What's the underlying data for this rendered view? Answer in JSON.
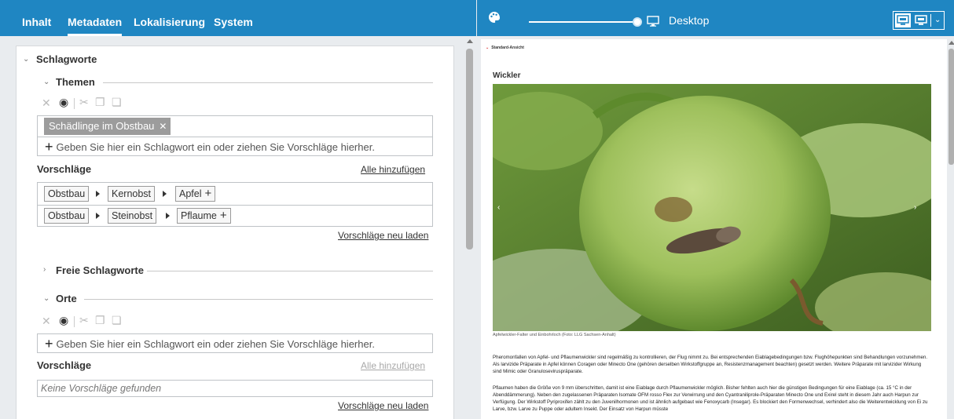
{
  "left": {
    "tabs": [
      {
        "label": "Inhalt",
        "active": false
      },
      {
        "label": "Metadaten",
        "active": true
      },
      {
        "label": "Lokalisierung",
        "active": false
      },
      {
        "label": "System",
        "active": false
      }
    ],
    "keywords_section": {
      "title": "Schlagworte",
      "themes": {
        "title": "Themen",
        "selected_tag": "Schädlinge im Obstbau",
        "input_placeholder": "Geben Sie hier ein Schlagwort ein oder ziehen Sie Vorschläge hierher.",
        "suggestions_label": "Vorschläge",
        "add_all": "Alle hinzufügen",
        "suggestion_rows": [
          [
            "Obstbau",
            "Kernobst",
            "Apfel"
          ],
          [
            "Obstbau",
            "Steinobst",
            "Pflaume"
          ]
        ],
        "reload": "Vorschläge neu laden"
      },
      "free": {
        "title": "Freie Schlagworte"
      },
      "places": {
        "title": "Orte",
        "input_placeholder": "Geben Sie hier ein Schlagwort ein oder ziehen Sie Vorschläge hierher.",
        "suggestions_label": "Vorschläge",
        "add_all": "Alle hinzufügen",
        "empty": "Keine Vorschläge gefunden",
        "reload": "Vorschläge neu laden"
      }
    }
  },
  "right": {
    "device_label": "Desktop",
    "view_label": "Standard-Ansicht",
    "article": {
      "heading": "Wickler",
      "caption": "Apfelwickler-Falter und Einbohrloch (Foto: LLG Sachsen-Anhalt)",
      "paragraph_1": "Pheromonfallen von Apfel- und Pflaumenwickler sind regelmäßig zu kontrollieren, der Flug nimmt zu. Bei entsprechenden Eiablagebedingungen bzw. Flughöhepunkten sind Behandlungen vorzunehmen. Als larvizide Präparate in Apfel können Coragen oder Minecto One (gehören derselben Wirkstoffgruppe an, Resistenzmanagement beachten) gesetzt werden. Weitere Präparate mit larvizider Wirkung sind Mimic oder Granuloseviruspräparate.",
      "paragraph_2": "Pflaumen haben die Größe von 9 mm überschritten, damit ist eine Eiablage durch Pflaumenwickler möglich. Bisher fehlten auch hier die günstigen Bedingungen für eine Eiablage (ca. 15 °C in der Abenddämmerung). Neben den zugelassenen Präparaten Isomate OFM rosso Flex zur Verwirrung und den Cyantraniliprole-Präparaten Minecto One und Exirel steht in diesem Jahr auch Harpun zur Verfügung. Der Wirkstoff Pyriproxifen zählt zu den Juvenilhormonen und ist ähnlich aufgebaut wie Fenoxycarb (Insegar). Es blockiert den Formenwechsel, verhindert also die Weiterentwicklung von Ei zu Larve, bzw. Larve zu Puppe oder adultem Insekt. Der Einsatz von Harpun müsste"
    }
  },
  "colors": {
    "topbar": "#1f86c2",
    "tag": "#9c9c9c",
    "panel_bg": "#e9ecef"
  },
  "icons": [
    "palette-icon",
    "monitor-icon",
    "desktop-view-icon",
    "tablet-view-icon",
    "chevron-down-icon",
    "delete-icon",
    "eye-icon",
    "cut-icon",
    "copy-icon",
    "paste-icon",
    "plus-icon"
  ]
}
